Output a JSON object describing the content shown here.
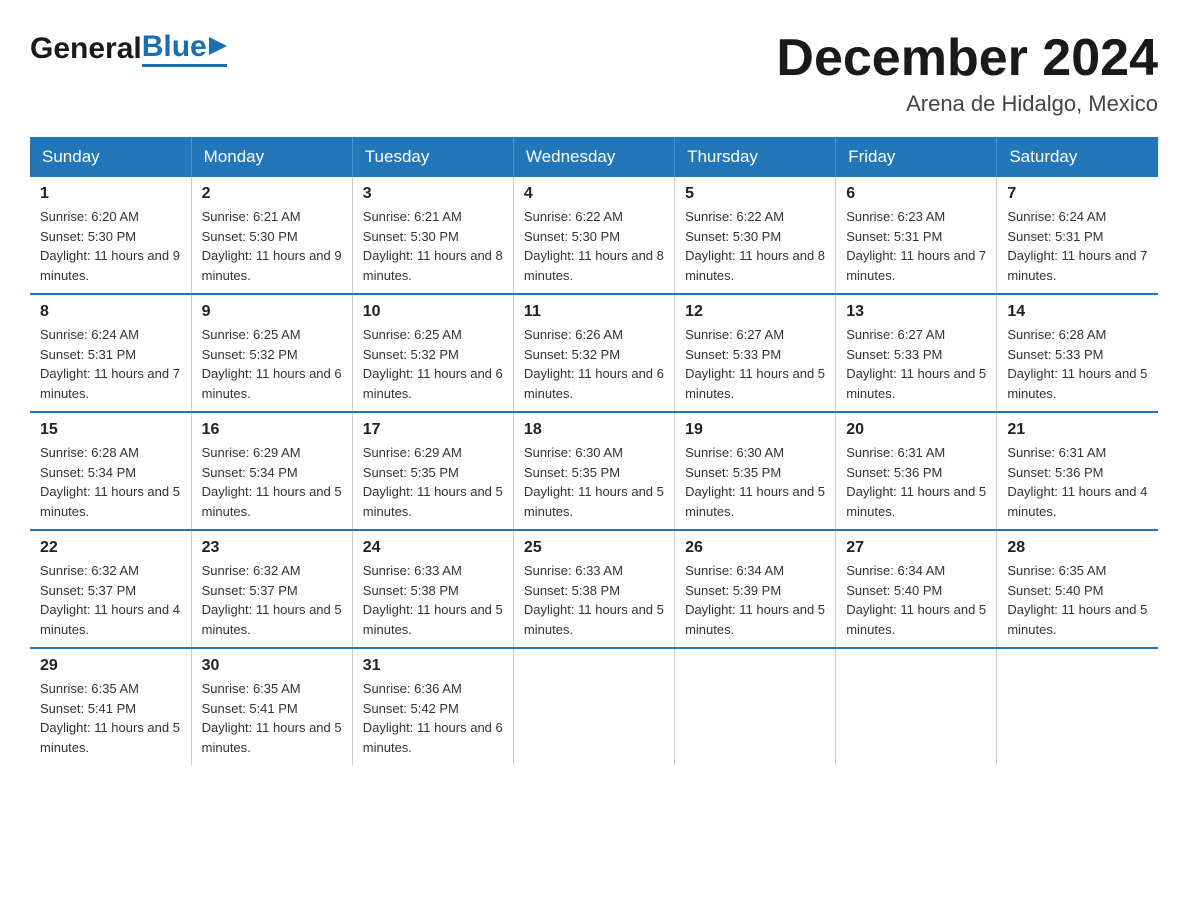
{
  "header": {
    "logo_general": "General",
    "logo_blue": "Blue",
    "month_title": "December 2024",
    "location": "Arena de Hidalgo, Mexico"
  },
  "calendar": {
    "days_of_week": [
      "Sunday",
      "Monday",
      "Tuesday",
      "Wednesday",
      "Thursday",
      "Friday",
      "Saturday"
    ],
    "weeks": [
      [
        {
          "day": "1",
          "sunrise": "Sunrise: 6:20 AM",
          "sunset": "Sunset: 5:30 PM",
          "daylight": "Daylight: 11 hours and 9 minutes."
        },
        {
          "day": "2",
          "sunrise": "Sunrise: 6:21 AM",
          "sunset": "Sunset: 5:30 PM",
          "daylight": "Daylight: 11 hours and 9 minutes."
        },
        {
          "day": "3",
          "sunrise": "Sunrise: 6:21 AM",
          "sunset": "Sunset: 5:30 PM",
          "daylight": "Daylight: 11 hours and 8 minutes."
        },
        {
          "day": "4",
          "sunrise": "Sunrise: 6:22 AM",
          "sunset": "Sunset: 5:30 PM",
          "daylight": "Daylight: 11 hours and 8 minutes."
        },
        {
          "day": "5",
          "sunrise": "Sunrise: 6:22 AM",
          "sunset": "Sunset: 5:30 PM",
          "daylight": "Daylight: 11 hours and 8 minutes."
        },
        {
          "day": "6",
          "sunrise": "Sunrise: 6:23 AM",
          "sunset": "Sunset: 5:31 PM",
          "daylight": "Daylight: 11 hours and 7 minutes."
        },
        {
          "day": "7",
          "sunrise": "Sunrise: 6:24 AM",
          "sunset": "Sunset: 5:31 PM",
          "daylight": "Daylight: 11 hours and 7 minutes."
        }
      ],
      [
        {
          "day": "8",
          "sunrise": "Sunrise: 6:24 AM",
          "sunset": "Sunset: 5:31 PM",
          "daylight": "Daylight: 11 hours and 7 minutes."
        },
        {
          "day": "9",
          "sunrise": "Sunrise: 6:25 AM",
          "sunset": "Sunset: 5:32 PM",
          "daylight": "Daylight: 11 hours and 6 minutes."
        },
        {
          "day": "10",
          "sunrise": "Sunrise: 6:25 AM",
          "sunset": "Sunset: 5:32 PM",
          "daylight": "Daylight: 11 hours and 6 minutes."
        },
        {
          "day": "11",
          "sunrise": "Sunrise: 6:26 AM",
          "sunset": "Sunset: 5:32 PM",
          "daylight": "Daylight: 11 hours and 6 minutes."
        },
        {
          "day": "12",
          "sunrise": "Sunrise: 6:27 AM",
          "sunset": "Sunset: 5:33 PM",
          "daylight": "Daylight: 11 hours and 5 minutes."
        },
        {
          "day": "13",
          "sunrise": "Sunrise: 6:27 AM",
          "sunset": "Sunset: 5:33 PM",
          "daylight": "Daylight: 11 hours and 5 minutes."
        },
        {
          "day": "14",
          "sunrise": "Sunrise: 6:28 AM",
          "sunset": "Sunset: 5:33 PM",
          "daylight": "Daylight: 11 hours and 5 minutes."
        }
      ],
      [
        {
          "day": "15",
          "sunrise": "Sunrise: 6:28 AM",
          "sunset": "Sunset: 5:34 PM",
          "daylight": "Daylight: 11 hours and 5 minutes."
        },
        {
          "day": "16",
          "sunrise": "Sunrise: 6:29 AM",
          "sunset": "Sunset: 5:34 PM",
          "daylight": "Daylight: 11 hours and 5 minutes."
        },
        {
          "day": "17",
          "sunrise": "Sunrise: 6:29 AM",
          "sunset": "Sunset: 5:35 PM",
          "daylight": "Daylight: 11 hours and 5 minutes."
        },
        {
          "day": "18",
          "sunrise": "Sunrise: 6:30 AM",
          "sunset": "Sunset: 5:35 PM",
          "daylight": "Daylight: 11 hours and 5 minutes."
        },
        {
          "day": "19",
          "sunrise": "Sunrise: 6:30 AM",
          "sunset": "Sunset: 5:35 PM",
          "daylight": "Daylight: 11 hours and 5 minutes."
        },
        {
          "day": "20",
          "sunrise": "Sunrise: 6:31 AM",
          "sunset": "Sunset: 5:36 PM",
          "daylight": "Daylight: 11 hours and 5 minutes."
        },
        {
          "day": "21",
          "sunrise": "Sunrise: 6:31 AM",
          "sunset": "Sunset: 5:36 PM",
          "daylight": "Daylight: 11 hours and 4 minutes."
        }
      ],
      [
        {
          "day": "22",
          "sunrise": "Sunrise: 6:32 AM",
          "sunset": "Sunset: 5:37 PM",
          "daylight": "Daylight: 11 hours and 4 minutes."
        },
        {
          "day": "23",
          "sunrise": "Sunrise: 6:32 AM",
          "sunset": "Sunset: 5:37 PM",
          "daylight": "Daylight: 11 hours and 5 minutes."
        },
        {
          "day": "24",
          "sunrise": "Sunrise: 6:33 AM",
          "sunset": "Sunset: 5:38 PM",
          "daylight": "Daylight: 11 hours and 5 minutes."
        },
        {
          "day": "25",
          "sunrise": "Sunrise: 6:33 AM",
          "sunset": "Sunset: 5:38 PM",
          "daylight": "Daylight: 11 hours and 5 minutes."
        },
        {
          "day": "26",
          "sunrise": "Sunrise: 6:34 AM",
          "sunset": "Sunset: 5:39 PM",
          "daylight": "Daylight: 11 hours and 5 minutes."
        },
        {
          "day": "27",
          "sunrise": "Sunrise: 6:34 AM",
          "sunset": "Sunset: 5:40 PM",
          "daylight": "Daylight: 11 hours and 5 minutes."
        },
        {
          "day": "28",
          "sunrise": "Sunrise: 6:35 AM",
          "sunset": "Sunset: 5:40 PM",
          "daylight": "Daylight: 11 hours and 5 minutes."
        }
      ],
      [
        {
          "day": "29",
          "sunrise": "Sunrise: 6:35 AM",
          "sunset": "Sunset: 5:41 PM",
          "daylight": "Daylight: 11 hours and 5 minutes."
        },
        {
          "day": "30",
          "sunrise": "Sunrise: 6:35 AM",
          "sunset": "Sunset: 5:41 PM",
          "daylight": "Daylight: 11 hours and 5 minutes."
        },
        {
          "day": "31",
          "sunrise": "Sunrise: 6:36 AM",
          "sunset": "Sunset: 5:42 PM",
          "daylight": "Daylight: 11 hours and 6 minutes."
        },
        null,
        null,
        null,
        null
      ]
    ]
  }
}
